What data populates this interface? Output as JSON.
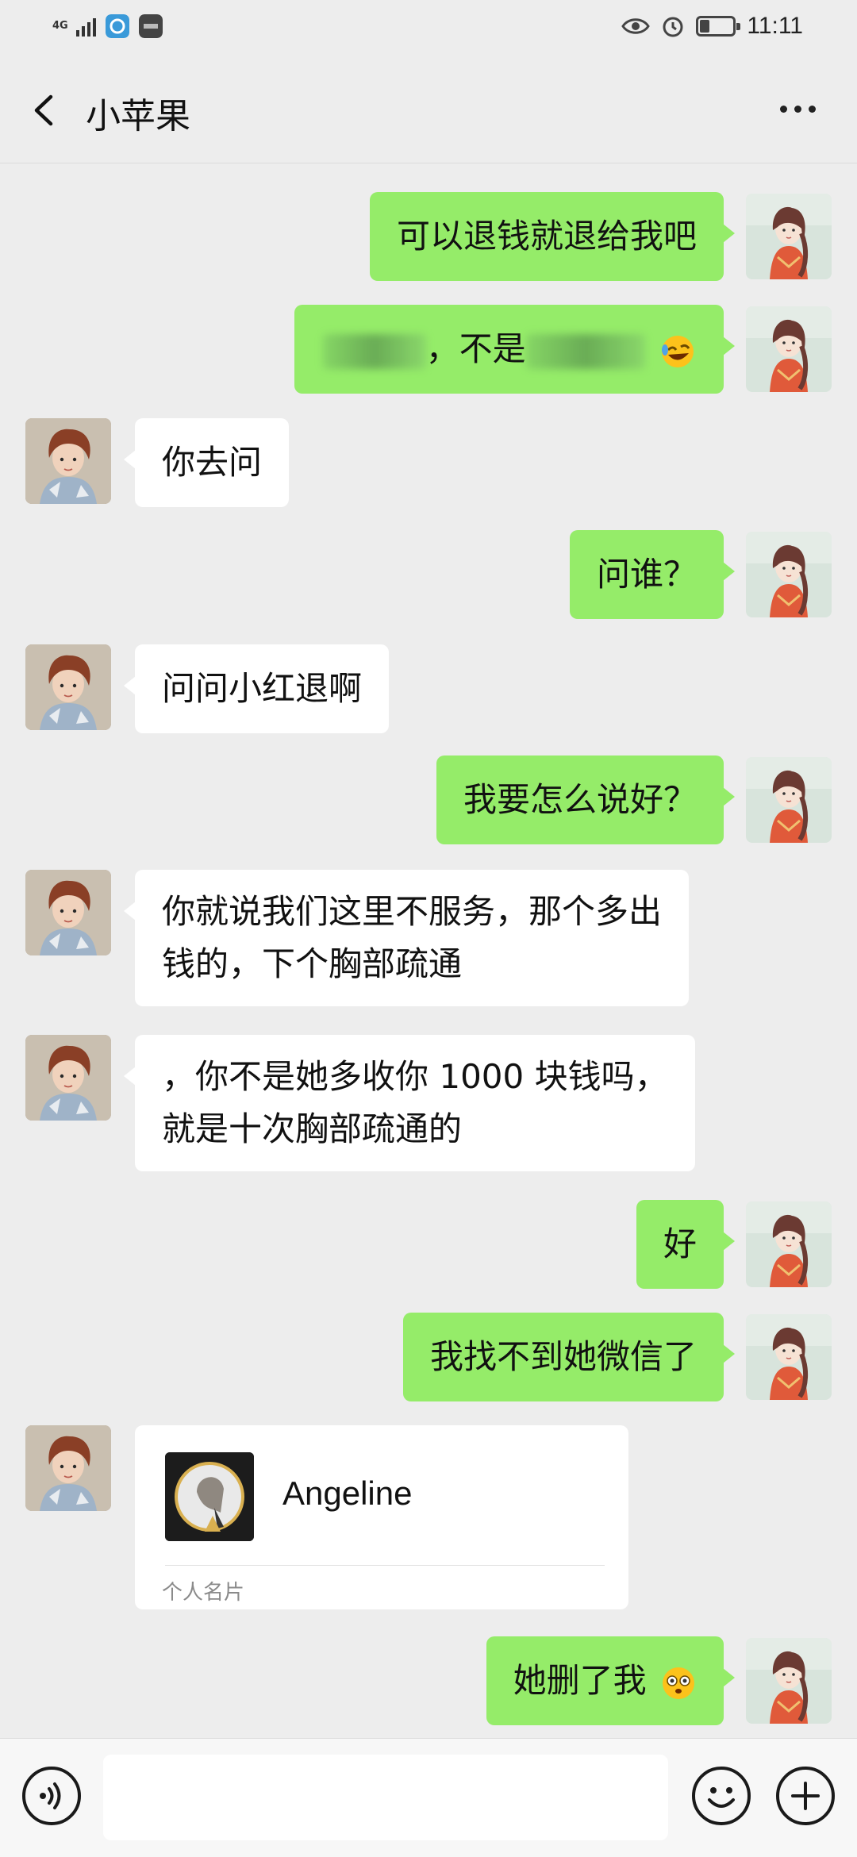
{
  "status_bar": {
    "network": "4G",
    "time": "11:11",
    "battery_level": 0.3,
    "icons": [
      "signal-icon",
      "browser-app-icon",
      "huawei-app-icon",
      "eye-icon",
      "alarm-icon",
      "battery-icon"
    ]
  },
  "header": {
    "title": "小苹果",
    "back_icon": "chevron-left-icon",
    "more_icon": "more-dots-icon"
  },
  "messages": [
    {
      "side": "sent",
      "text": "可以退钱就退给我吧"
    },
    {
      "side": "sent",
      "text_before": "",
      "text_mid": "，不是",
      "emoji": "rolling-laugh-emoji",
      "redacted": true
    },
    {
      "side": "recv",
      "text": "你去问"
    },
    {
      "side": "sent",
      "text": "问谁？"
    },
    {
      "side": "recv",
      "text": "问问小红退啊"
    },
    {
      "side": "sent",
      "text": "我要怎么说好？"
    },
    {
      "side": "recv",
      "lines": [
        "你就说我们这里不服务，那个多出",
        "钱的，下个胸部疏通"
      ]
    },
    {
      "side": "recv",
      "lines": [
        "，你不是她多收你 1000 块钱吗，",
        "就是十次胸部疏通的"
      ]
    },
    {
      "side": "sent",
      "text": "好"
    },
    {
      "side": "sent",
      "text": "我找不到她微信了"
    },
    {
      "side": "recv",
      "type": "contact_card",
      "name": "Angeline",
      "card_label": "个人名片"
    },
    {
      "side": "sent",
      "text": "她删了我",
      "emoji": "flushed-face-emoji"
    }
  ],
  "input_bar": {
    "voice_icon": "voice-icon",
    "emoji_icon": "smiley-icon",
    "plus_icon": "plus-icon",
    "value": ""
  },
  "colors": {
    "background": "#ededed",
    "sent_bubble": "#95ec69",
    "received_bubble": "#ffffff"
  }
}
